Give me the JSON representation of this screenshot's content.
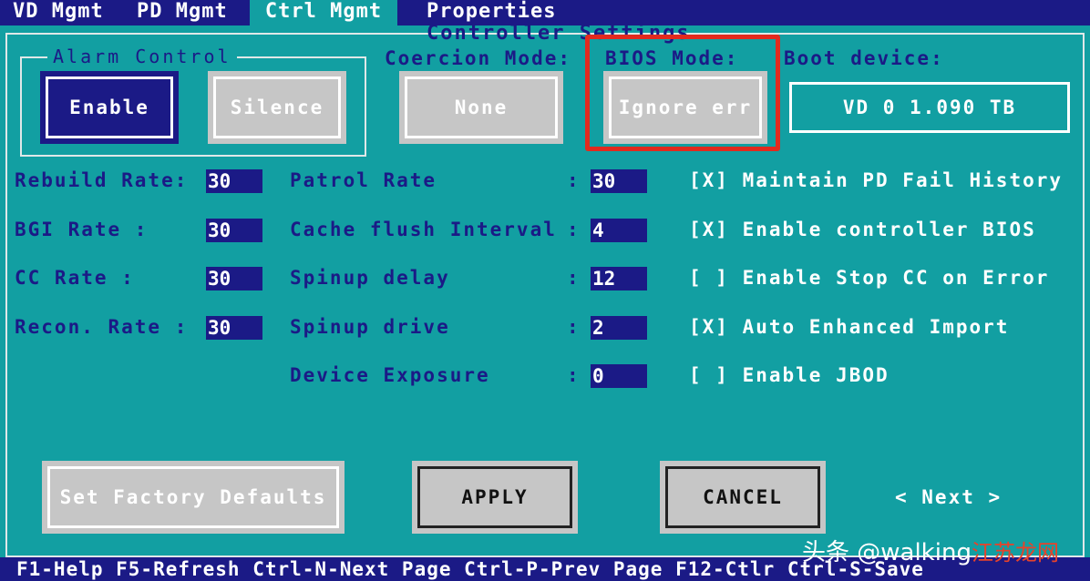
{
  "tabs": [
    {
      "label": "VD Mgmt"
    },
    {
      "label": "PD Mgmt"
    },
    {
      "label": "Ctrl Mgmt"
    },
    {
      "label": "Properties"
    }
  ],
  "panel_title": "Controller Settings",
  "alarm": {
    "legend": "Alarm Control",
    "enable": "Enable",
    "silence": "Silence"
  },
  "coercion": {
    "label": "Coercion Mode:",
    "value": "None"
  },
  "bios": {
    "label": "BIOS Mode:",
    "value": "Ignore err"
  },
  "boot": {
    "label": "Boot device:",
    "value": "VD  0 1.090 TB"
  },
  "rates_left": [
    {
      "label": "Rebuild Rate:",
      "value": "30"
    },
    {
      "label": "BGI Rate     :",
      "value": "30"
    },
    {
      "label": "CC  Rate     :",
      "value": "30"
    },
    {
      "label": "Recon. Rate  :",
      "value": "30"
    }
  ],
  "rates_mid": [
    {
      "label": "Patrol Rate",
      "value": "30"
    },
    {
      "label": "Cache flush Interval",
      "value": "4"
    },
    {
      "label": "Spinup delay",
      "value": "12"
    },
    {
      "label": "Spinup drive",
      "value": "2"
    },
    {
      "label": "Device Exposure",
      "value": "0"
    }
  ],
  "colon": ":",
  "checkboxes": [
    {
      "mark": "[X]",
      "label": "Maintain PD Fail History"
    },
    {
      "mark": "[X]",
      "label": "Enable controller BIOS"
    },
    {
      "mark": "[ ]",
      "label": "Enable Stop CC on Error"
    },
    {
      "mark": "[X]",
      "label": "Auto Enhanced Import"
    },
    {
      "mark": "[ ]",
      "label": "Enable JBOD"
    }
  ],
  "buttons": {
    "factory": "Set Factory Defaults",
    "apply": "APPLY",
    "cancel": "CANCEL",
    "next": "< Next >"
  },
  "status_bar": "F1-Help F5-Refresh Ctrl-N-Next Page Ctrl-P-Prev Page F12-Ctlr Ctrl-S-Save",
  "watermark": {
    "prefix": "头条 @walking",
    "suffix": "江苏龙网"
  },
  "colors": {
    "background": "#129fa2",
    "navy": "#1b1a86",
    "highlight": "#e22a1e"
  }
}
